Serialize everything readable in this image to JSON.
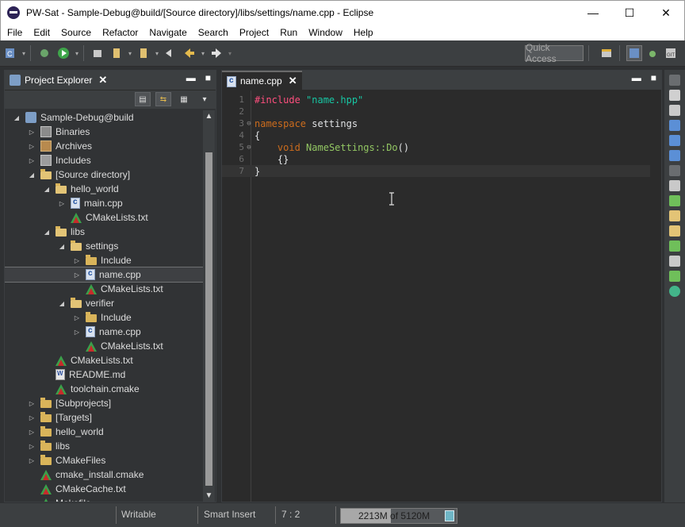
{
  "window": {
    "title": "PW-Sat - Sample-Debug@build/[Source directory]/libs/settings/name.cpp - Eclipse",
    "minimize": "—",
    "maximize": "☐",
    "close": "✕"
  },
  "menu": [
    "File",
    "Edit",
    "Source",
    "Refactor",
    "Navigate",
    "Search",
    "Project",
    "Run",
    "Window",
    "Help"
  ],
  "toolbar": {
    "quick_access": "Quick Access"
  },
  "project_explorer": {
    "tab_label": "Project Explorer",
    "tree": [
      {
        "label": "Sample-Debug@build",
        "icon": "project-icon",
        "depth": 0,
        "expanded": true
      },
      {
        "label": "Binaries",
        "icon": "binaries-icon",
        "depth": 1,
        "expanded": false
      },
      {
        "label": "Archives",
        "icon": "archives-icon",
        "depth": 1,
        "expanded": false
      },
      {
        "label": "Includes",
        "icon": "includes-icon",
        "depth": 1,
        "expanded": false
      },
      {
        "label": "[Source directory]",
        "icon": "source-folder-icon",
        "depth": 1,
        "expanded": true
      },
      {
        "label": "hello_world",
        "icon": "folder-icon",
        "depth": 2,
        "expanded": true
      },
      {
        "label": "main.cpp",
        "icon": "cpp-file-icon",
        "depth": 3,
        "expanded": false
      },
      {
        "label": "CMakeLists.txt",
        "icon": "cmake-icon",
        "depth": 3,
        "leaf": true
      },
      {
        "label": "libs",
        "icon": "folder-icon",
        "depth": 2,
        "expanded": true
      },
      {
        "label": "settings",
        "icon": "folder-icon",
        "depth": 3,
        "expanded": true
      },
      {
        "label": "Include",
        "icon": "folder-icon",
        "depth": 4,
        "expanded": false
      },
      {
        "label": "name.cpp",
        "icon": "cpp-file-icon",
        "depth": 4,
        "expanded": false,
        "selected": true
      },
      {
        "label": "CMakeLists.txt",
        "icon": "cmake-icon",
        "depth": 4,
        "leaf": true
      },
      {
        "label": "verifier",
        "icon": "folder-icon",
        "depth": 3,
        "expanded": true
      },
      {
        "label": "Include",
        "icon": "folder-icon",
        "depth": 4,
        "expanded": false
      },
      {
        "label": "name.cpp",
        "icon": "cpp-file-icon",
        "depth": 4,
        "expanded": false
      },
      {
        "label": "CMakeLists.txt",
        "icon": "cmake-icon",
        "depth": 4,
        "leaf": true
      },
      {
        "label": "CMakeLists.txt",
        "icon": "cmake-icon",
        "depth": 2,
        "leaf": true
      },
      {
        "label": "README.md",
        "icon": "readme-icon",
        "depth": 2,
        "leaf": true
      },
      {
        "label": "toolchain.cmake",
        "icon": "cmake-icon",
        "depth": 2,
        "leaf": true
      },
      {
        "label": "[Subprojects]",
        "icon": "folder-icon",
        "depth": 1,
        "expanded": false
      },
      {
        "label": "[Targets]",
        "icon": "folder-icon",
        "depth": 1,
        "expanded": false
      },
      {
        "label": "hello_world",
        "icon": "folder-icon",
        "depth": 1,
        "expanded": false
      },
      {
        "label": "libs",
        "icon": "folder-icon",
        "depth": 1,
        "expanded": false
      },
      {
        "label": "CMakeFiles",
        "icon": "folder-icon",
        "depth": 1,
        "expanded": false
      },
      {
        "label": "cmake_install.cmake",
        "icon": "cmake-icon",
        "depth": 1,
        "leaf": true
      },
      {
        "label": "CMakeCache.txt",
        "icon": "cmake-icon",
        "depth": 1,
        "leaf": true
      },
      {
        "label": "Makefile",
        "icon": "cmake-icon",
        "depth": 1,
        "leaf": true
      }
    ]
  },
  "editor": {
    "tab_label": "name.cpp",
    "lines": [
      {
        "n": "1",
        "fold": "",
        "tokens": [
          {
            "t": "#include",
            "c": "tk-pre"
          },
          {
            "t": " ",
            "c": "tk-plain"
          },
          {
            "t": "\"name.hpp\"",
            "c": "tk-str"
          }
        ]
      },
      {
        "n": "2",
        "fold": "",
        "tokens": []
      },
      {
        "n": "3",
        "fold": "⊖",
        "tokens": [
          {
            "t": "namespace",
            "c": "tk-kw"
          },
          {
            "t": " settings",
            "c": "tk-ns"
          }
        ]
      },
      {
        "n": "4",
        "fold": "",
        "tokens": [
          {
            "t": "{",
            "c": "tk-plain"
          }
        ]
      },
      {
        "n": "5",
        "fold": "⊖",
        "tokens": [
          {
            "t": "    ",
            "c": "tk-plain"
          },
          {
            "t": "void",
            "c": "tk-kw2"
          },
          {
            "t": " ",
            "c": "tk-plain"
          },
          {
            "t": "NameSettings::Do",
            "c": "tk-fn"
          },
          {
            "t": "()",
            "c": "tk-plain"
          }
        ]
      },
      {
        "n": "6",
        "fold": "",
        "tokens": [
          {
            "t": "    {}",
            "c": "tk-plain"
          }
        ]
      },
      {
        "n": "7",
        "fold": "",
        "tokens": [
          {
            "t": "}",
            "c": "tk-plain"
          }
        ],
        "current": true
      }
    ]
  },
  "status": {
    "writable": "Writable",
    "insert_mode": "Smart Insert",
    "cursor_pos": "7 : 2",
    "heap_used": "2213M",
    "heap_total": "of 5120M",
    "heap_fraction": 0.432
  },
  "colors": {
    "background": "#2b2b2b",
    "panel": "#3c3f41",
    "keyword": "#cc6c1d",
    "function": "#93c763",
    "string": "#17c6a3",
    "preprocessor": "#ff4f7e"
  }
}
